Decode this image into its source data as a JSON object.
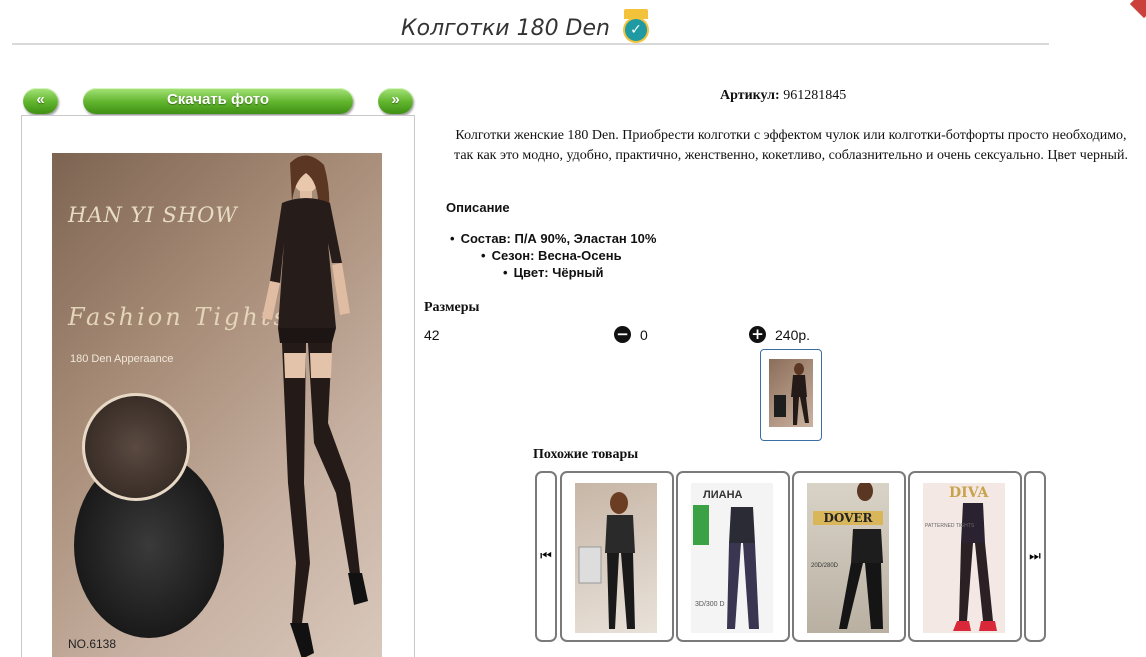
{
  "product": {
    "title": "Колготки 180 Den",
    "verified_icon": "check-circle-icon",
    "article_label": "Артикул:",
    "article_value": "961281845",
    "description": "Колготки женские 180 Den. Приобрести колготки с эффектом чулок или колготки-ботфорты просто необходимо, так как это модно, удобно, практично, женственно, кокетливо, соблазнительно и очень сексуально. Цвет черный.",
    "details_heading": "Описание",
    "specs": [
      "Состав: П/А 90%, Эластан 10%",
      "Сезон: Весна-Осень",
      "Цвет: Чёрный"
    ]
  },
  "gallery": {
    "prev_label": "«",
    "download_label": "Скачать фото",
    "next_label": "»",
    "photo_brand": "HAN YI SHOW",
    "photo_script": "Fashion  Tights",
    "photo_subtitle": "180 Den Apperaance",
    "photo_number": "NO.6138"
  },
  "sizes": {
    "heading": "Размеры",
    "rows": [
      {
        "size": "42",
        "quantity": "0",
        "price": "240р."
      }
    ]
  },
  "similar": {
    "heading": "Похожие товары",
    "prev_icon": "skip-back-icon",
    "next_icon": "skip-forward-icon",
    "items": [
      {
        "brand": "",
        "icon": "product-thumbnail"
      },
      {
        "brand": "ЛИАНА",
        "subtitle": "3D/300 D"
      },
      {
        "brand": "DOVER",
        "subtitle": "20D/280D"
      },
      {
        "brand": "DIVA",
        "subtitle": "PATTERNED TIGHTS"
      }
    ]
  },
  "colors": {
    "button_green": "#5fb42c",
    "badge_teal": "#1f9aa2",
    "badge_gold": "#f2c23a"
  }
}
